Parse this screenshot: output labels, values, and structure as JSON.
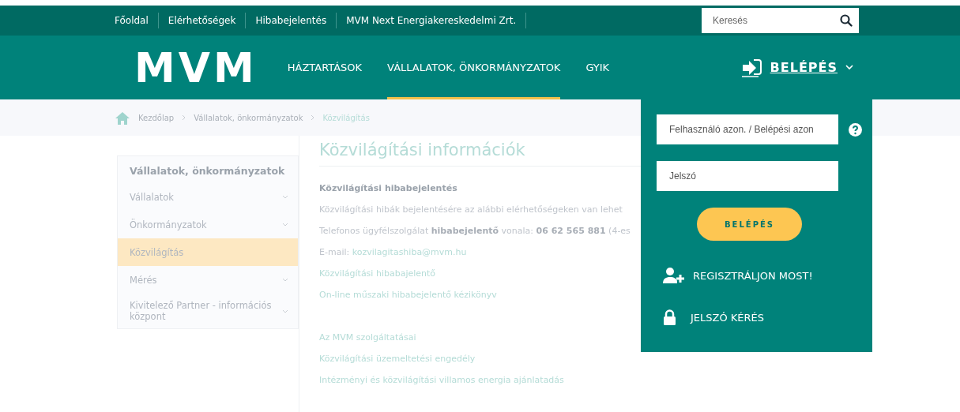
{
  "top_bar": {
    "links": [
      "Főoldal",
      "Elérhetőségek",
      "Hibabejelentés",
      "MVM Next Energiakereskedelmi Zrt."
    ],
    "search": {
      "placeholder": "Keresés"
    }
  },
  "nav": {
    "logo": "MVM",
    "items": [
      {
        "label": "HÁZTARTÁSOK",
        "selected": false
      },
      {
        "label": "VÁLLALATOK, ÖNKORMÁNYZATOK",
        "selected": true
      },
      {
        "label": "GYIK",
        "selected": false
      }
    ],
    "login": {
      "label": "BELÉPÉS",
      "expanded": true
    }
  },
  "breadcrumb": [
    "Kezdőlap",
    "Vállalatok, önkormányzatok",
    "Közvilágítás"
  ],
  "sidebar": {
    "title": "Vállalatok, önkormányzatok",
    "items": [
      {
        "label": "Vállalatok",
        "expandable": true,
        "selected": false
      },
      {
        "label": "Önkormányzatok",
        "expandable": true,
        "selected": false
      },
      {
        "label": "Közvilágítás",
        "expandable": false,
        "selected": true
      },
      {
        "label": "Mérés",
        "expandable": true,
        "selected": false
      },
      {
        "label": "Kivitelező Partner - információs központ",
        "expandable": true,
        "selected": false
      }
    ]
  },
  "content": {
    "title": "Közvilágítási információk",
    "groups": [
      [
        {
          "kind": "heading",
          "text": "Közvilágítási hibabejelentés"
        },
        {
          "kind": "text",
          "text": "Közvilágítási hibák bejelentésére az alábbi elérhetőségeken van lehet"
        },
        {
          "kind": "text",
          "text": "Telefonos ügyfélszolgálat **hibabejelentő** vonala: **06 62 565 881** (4-es"
        },
        {
          "kind": "email",
          "text": "E-mail:",
          "link": "kozvilagitashiba@mvm.hu"
        },
        {
          "kind": "link",
          "text": "Közvilágítási hibabajelentő"
        },
        {
          "kind": "link",
          "text": "On-line műszaki hibabejelentő kézikönyv"
        }
      ],
      [
        {
          "kind": "link",
          "text": "Az MVM szolgáltatásai"
        },
        {
          "kind": "link",
          "text": "Közvilágítási üzemeltetési engedély"
        },
        {
          "kind": "link",
          "text": "Intézményi és közvilágítási villamos energia ajánlatadás"
        }
      ]
    ]
  },
  "login_panel": {
    "username": {
      "placeholder": "Felhasználó azon. / Belépési azon"
    },
    "password": {
      "placeholder": "Jelszó"
    },
    "button": "BELÉPÉS",
    "links": [
      {
        "kind": "register",
        "label": "REGISZTRÁLJON MOST!"
      },
      {
        "kind": "password",
        "label": "JELSZÓ KÉRÉS"
      }
    ]
  }
}
